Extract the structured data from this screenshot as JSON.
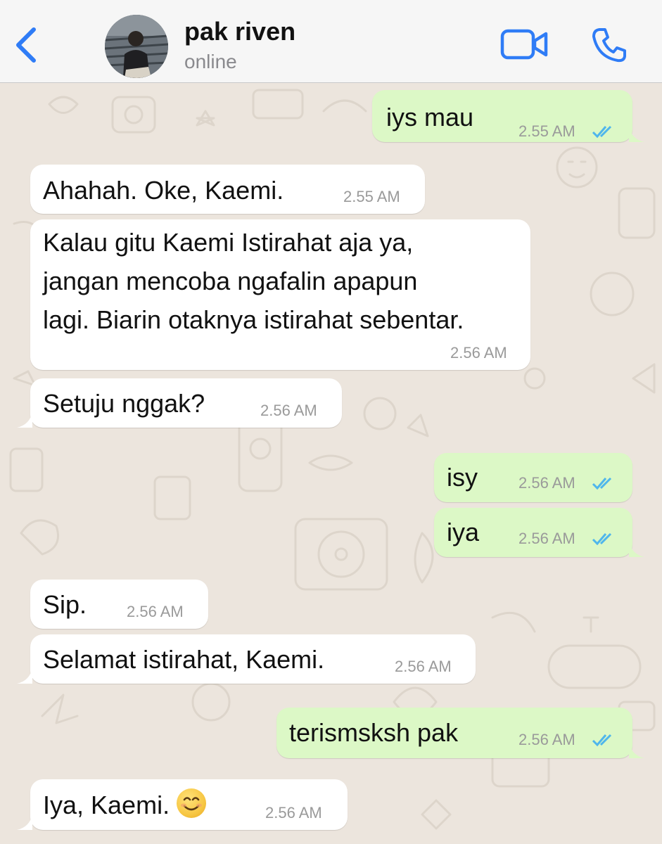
{
  "header": {
    "contact_name": "pak riven",
    "status": "online"
  },
  "icons": {
    "back": "chevron-left-icon",
    "video": "video-camera-icon",
    "call": "phone-icon",
    "read_receipt": "double-check-icon",
    "emoji": "smiling-face-emoji"
  },
  "colors": {
    "accent": "#2F7CF6",
    "outgoing_bubble": "#DCF8C6",
    "incoming_bubble": "#FFFFFF",
    "read_ticks": "#4FB6EC"
  },
  "messages": [
    {
      "direction": "out",
      "text": "iys mau",
      "time": "2.55 AM",
      "read": true
    },
    {
      "direction": "in",
      "text": "Ahahah. Oke, Kaemi.",
      "time": "2.55 AM"
    },
    {
      "direction": "in",
      "lines": [
        "Kalau gitu Kaemi Istirahat aja ya,",
        "jangan mencoba ngafalin apapun",
        "lagi. Biarin otaknya istirahat sebentar."
      ],
      "time": "2.56 AM"
    },
    {
      "direction": "in",
      "text": "Setuju nggak?",
      "time": "2.56 AM"
    },
    {
      "direction": "out",
      "text": "isy",
      "time": "2.56 AM",
      "read": true
    },
    {
      "direction": "out",
      "text": "iya",
      "time": "2.56 AM",
      "read": true
    },
    {
      "direction": "in",
      "text": "Sip.",
      "time": "2.56 AM"
    },
    {
      "direction": "in",
      "text": "Selamat istirahat, Kaemi.",
      "time": "2.56 AM"
    },
    {
      "direction": "out",
      "text": "terismsksh pak",
      "time": "2.56 AM",
      "read": true
    },
    {
      "direction": "in",
      "text": "Iya, Kaemi.",
      "emoji": "😊",
      "time": "2.56 AM"
    }
  ]
}
